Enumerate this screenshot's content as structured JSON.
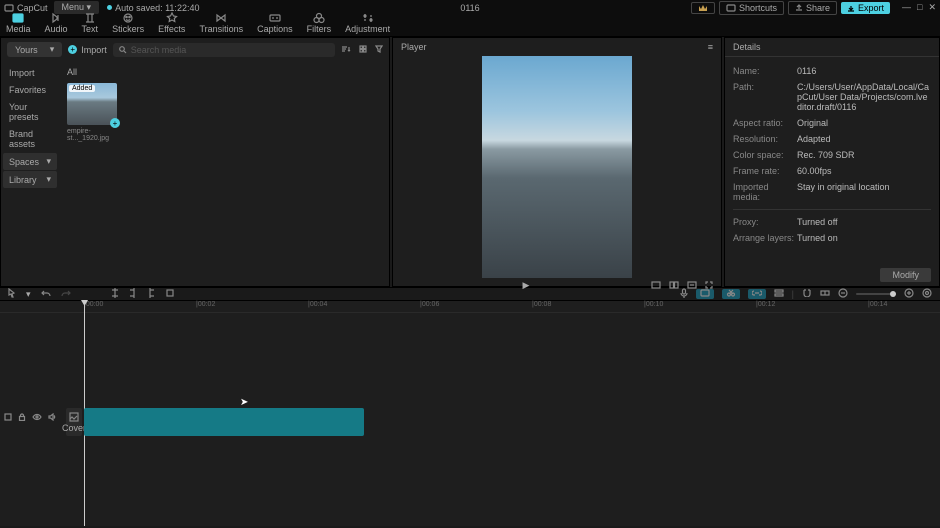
{
  "titlebar": {
    "app": "CapCut",
    "menu": "Menu",
    "autosave": "Auto saved: 11:22:40",
    "project": "0116",
    "vip": "",
    "shortcuts": "Shortcuts",
    "share": "Share",
    "export": "Export"
  },
  "tabs": [
    "Media",
    "Audio",
    "Text",
    "Stickers",
    "Effects",
    "Transitions",
    "Captions",
    "Filters",
    "Adjustment"
  ],
  "media": {
    "yours": "Yours",
    "import": "Import",
    "search_placeholder": "Search media",
    "sidebar": [
      {
        "label": "Import",
        "active": true
      },
      {
        "label": "Favorites"
      },
      {
        "label": "Your presets"
      },
      {
        "label": "Brand assets"
      },
      {
        "label": "Spaces",
        "box": true
      },
      {
        "label": "Library",
        "box": true
      }
    ],
    "subtab": "All",
    "thumb": {
      "badge": "Added",
      "name": "empire-st..._1920.jpg"
    }
  },
  "player": {
    "title": "Player",
    "time": "",
    "play": "▶"
  },
  "details": {
    "title": "Details",
    "rows": [
      {
        "lbl": "Name:",
        "val": "0116"
      },
      {
        "lbl": "Path:",
        "val": "C:/Users/User/AppData/Local/CapCut/User Data/Projects/com.lveditor.draft/0116"
      },
      {
        "lbl": "Aspect ratio:",
        "val": "Original"
      },
      {
        "lbl": "Resolution:",
        "val": "Adapted"
      },
      {
        "lbl": "Color space:",
        "val": "Rec. 709 SDR"
      },
      {
        "lbl": "Frame rate:",
        "val": "60.00fps"
      },
      {
        "lbl": "Imported media:",
        "val": "Stay in original location"
      }
    ],
    "rows2": [
      {
        "lbl": "Proxy:",
        "val": "Turned off"
      },
      {
        "lbl": "Arrange layers:",
        "val": "Turned on"
      }
    ],
    "modify": "Modify"
  },
  "ruler": [
    "|00:00",
    "|00:02",
    "|00:04",
    "|00:06",
    "|00:08",
    "|00:10",
    "|00:12",
    "|00:14"
  ],
  "cover": "Cover"
}
